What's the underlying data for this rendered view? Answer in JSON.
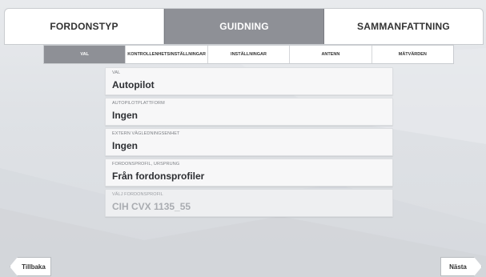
{
  "top_tabs": [
    {
      "label": "FORDONSTYP",
      "active": false
    },
    {
      "label": "GUIDNING",
      "active": true
    },
    {
      "label": "SAMMANFATTNING",
      "active": false
    }
  ],
  "sub_tabs": [
    {
      "label": "VAL",
      "active": true
    },
    {
      "label": "KONTROLLENHETSINSTÄLLNINGAR",
      "active": false
    },
    {
      "label": "INSTÄLLNINGAR",
      "active": false
    },
    {
      "label": "ANTENN",
      "active": false
    },
    {
      "label": "MÄTVÄRDEN",
      "active": false
    }
  ],
  "fields": [
    {
      "label": "VAL",
      "value": "Autopilot",
      "disabled": false
    },
    {
      "label": "AUTOPILOTPLATTFORM",
      "value": "Ingen",
      "disabled": false
    },
    {
      "label": "EXTERN VÄGLEDNINGSENHET",
      "value": "Ingen",
      "disabled": false
    },
    {
      "label": "FORDONSPROFIL, URSPRUNG",
      "value": "Från fordonsprofiler",
      "disabled": false
    },
    {
      "label": "VÄLJ FORDONSPROFIL",
      "value": "CIH CVX 1135_55",
      "disabled": true
    }
  ],
  "nav": {
    "back_label": "Tillbaka",
    "next_label": "Nästa"
  },
  "colors": {
    "active_tab": "#8e9096",
    "background": "#e3e5e8"
  }
}
